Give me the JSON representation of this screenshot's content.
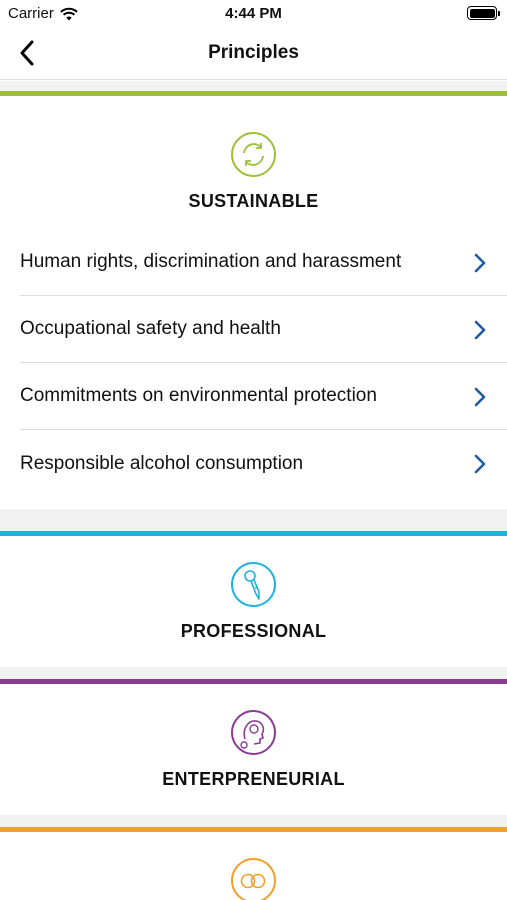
{
  "status_bar": {
    "carrier": "Carrier",
    "time": "4:44 PM",
    "icons": [
      "wifi-icon",
      "battery-icon"
    ]
  },
  "nav": {
    "title": "Principles",
    "back_icon": "chevron-left-icon"
  },
  "sections": [
    {
      "title": "SUSTAINABLE",
      "accent_color": "#9cc03b",
      "icon": "recycle-cycle-icon",
      "items": [
        {
          "label": "Human rights, discrimination and harassment"
        },
        {
          "label": "Occupational safety and health"
        },
        {
          "label": "Commitments on environmental protection"
        },
        {
          "label": "Responsible alcohol consumption"
        }
      ]
    },
    {
      "title": "PROFESSIONAL",
      "accent_color": "#1fb2dd",
      "icon": "pen-tool-icon",
      "items": []
    },
    {
      "title": "ENTERPRENEURIAL",
      "accent_color": "#8b3d96",
      "icon": "head-idea-icon",
      "items": []
    },
    {
      "title": "",
      "accent_color": "#f0a02a",
      "icon": "linked-rings-icon",
      "items": []
    }
  ],
  "colors": {
    "chevron": "#1f5aa6",
    "separator": "#dcdcdc",
    "section_gap": "#f1f1f1"
  }
}
